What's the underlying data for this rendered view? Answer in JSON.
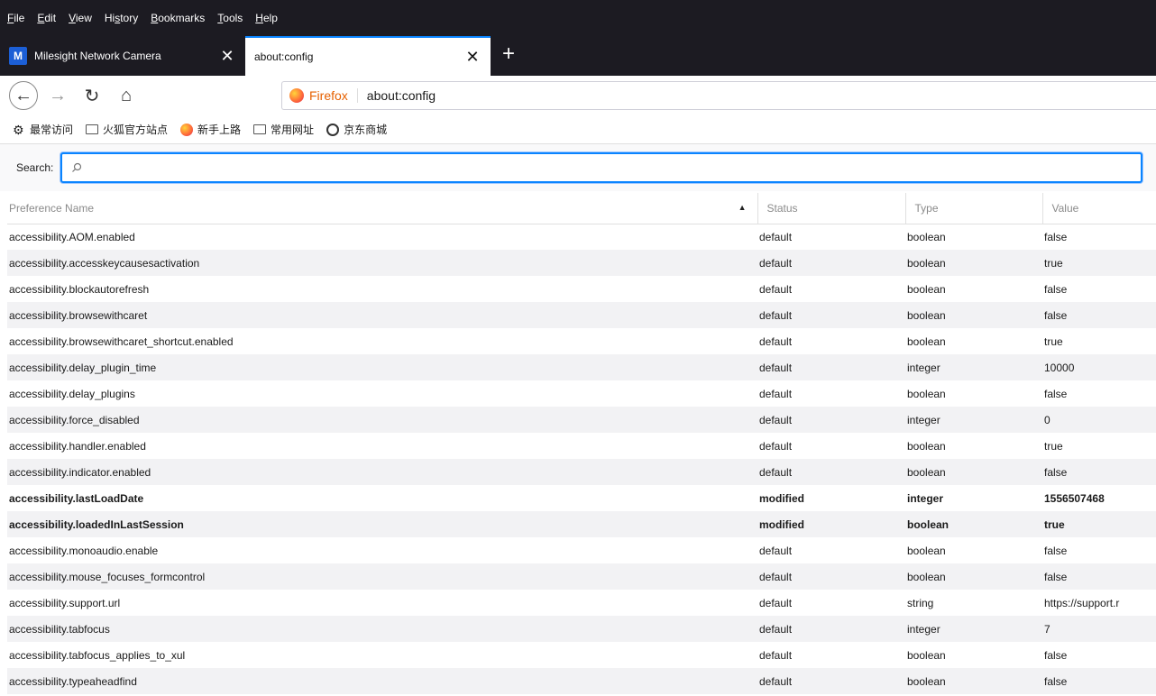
{
  "menubar": {
    "items": [
      {
        "hot": "F",
        "rest": "ile"
      },
      {
        "hot": "E",
        "rest": "dit"
      },
      {
        "hot": "V",
        "rest": "iew"
      },
      {
        "pre": "Hi",
        "hot": "s",
        "rest": "tory"
      },
      {
        "hot": "B",
        "rest": "ookmarks"
      },
      {
        "hot": "T",
        "rest": "ools"
      },
      {
        "hot": "H",
        "rest": "elp"
      }
    ]
  },
  "tabs": [
    {
      "favicon": "M",
      "title": "Milesight Network Camera",
      "close": "✕"
    },
    {
      "title": "about:config",
      "close": "✕"
    }
  ],
  "new_tab": "+",
  "nav": {
    "back": "←",
    "forward": "→",
    "reload": "↻",
    "home": "⌂",
    "identity": "Firefox",
    "url": "about:config"
  },
  "bookmarks": [
    {
      "icon": "gear-icon",
      "label": "最常访问"
    },
    {
      "icon": "folder-icon",
      "label": "火狐官方站点"
    },
    {
      "icon": "firefox-icon",
      "label": "新手上路"
    },
    {
      "icon": "folder-icon",
      "label": "常用网址"
    },
    {
      "icon": "globe-icon",
      "label": "京东商城"
    }
  ],
  "search": {
    "label": "Search:",
    "placeholder": ""
  },
  "table": {
    "headers": [
      "Preference Name",
      "Status",
      "Type",
      "Value"
    ],
    "sort_arrow": "▲",
    "rows": [
      {
        "name": "accessibility.AOM.enabled",
        "status": "default",
        "type": "boolean",
        "value": "false"
      },
      {
        "name": "accessibility.accesskeycausesactivation",
        "status": "default",
        "type": "boolean",
        "value": "true"
      },
      {
        "name": "accessibility.blockautorefresh",
        "status": "default",
        "type": "boolean",
        "value": "false"
      },
      {
        "name": "accessibility.browsewithcaret",
        "status": "default",
        "type": "boolean",
        "value": "false"
      },
      {
        "name": "accessibility.browsewithcaret_shortcut.enabled",
        "status": "default",
        "type": "boolean",
        "value": "true"
      },
      {
        "name": "accessibility.delay_plugin_time",
        "status": "default",
        "type": "integer",
        "value": "10000"
      },
      {
        "name": "accessibility.delay_plugins",
        "status": "default",
        "type": "boolean",
        "value": "false"
      },
      {
        "name": "accessibility.force_disabled",
        "status": "default",
        "type": "integer",
        "value": "0"
      },
      {
        "name": "accessibility.handler.enabled",
        "status": "default",
        "type": "boolean",
        "value": "true"
      },
      {
        "name": "accessibility.indicator.enabled",
        "status": "default",
        "type": "boolean",
        "value": "false"
      },
      {
        "name": "accessibility.lastLoadDate",
        "status": "modified",
        "type": "integer",
        "value": "1556507468"
      },
      {
        "name": "accessibility.loadedInLastSession",
        "status": "modified",
        "type": "boolean",
        "value": "true"
      },
      {
        "name": "accessibility.monoaudio.enable",
        "status": "default",
        "type": "boolean",
        "value": "false"
      },
      {
        "name": "accessibility.mouse_focuses_formcontrol",
        "status": "default",
        "type": "boolean",
        "value": "false"
      },
      {
        "name": "accessibility.support.url",
        "status": "default",
        "type": "string",
        "value": "https://support.r"
      },
      {
        "name": "accessibility.tabfocus",
        "status": "default",
        "type": "integer",
        "value": "7"
      },
      {
        "name": "accessibility.tabfocus_applies_to_xul",
        "status": "default",
        "type": "boolean",
        "value": "false"
      },
      {
        "name": "accessibility.typeaheadfind",
        "status": "default",
        "type": "boolean",
        "value": "false"
      }
    ]
  }
}
